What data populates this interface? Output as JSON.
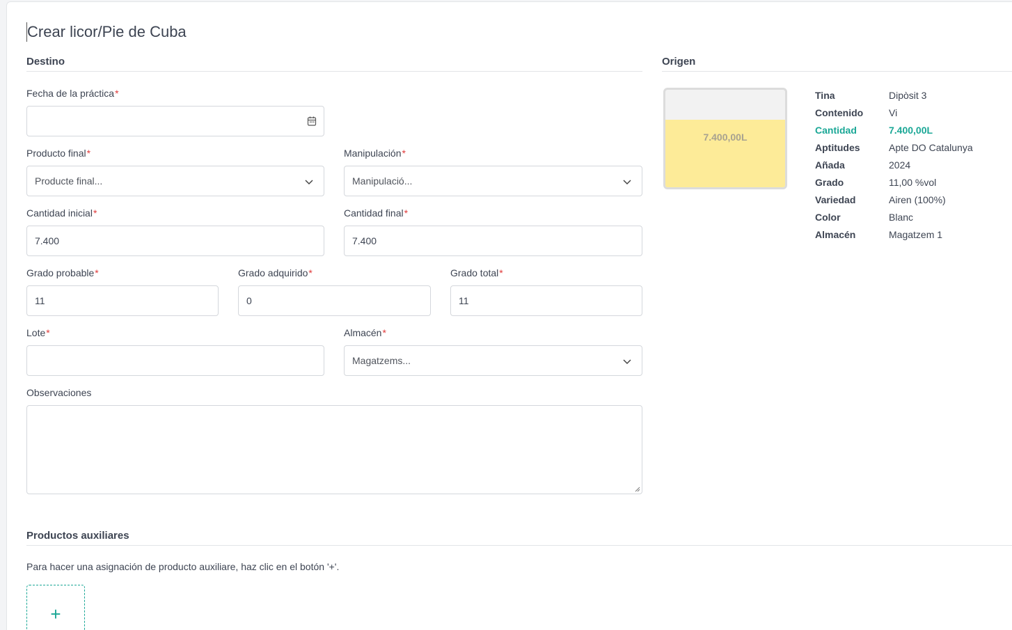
{
  "page": {
    "title": "Crear licor/Pie de Cuba"
  },
  "destino": {
    "title": "Destino",
    "fecha": {
      "label": "Fecha de la práctica",
      "value": ""
    },
    "producto_final": {
      "label": "Producto final",
      "placeholder": "Producte final..."
    },
    "manipulacion": {
      "label": "Manipulación",
      "placeholder": "Manipulació..."
    },
    "cantidad_inicial": {
      "label": "Cantidad inicial",
      "value": "7.400"
    },
    "cantidad_final": {
      "label": "Cantidad final",
      "value": "7.400"
    },
    "grado_probable": {
      "label": "Grado probable",
      "value": "11"
    },
    "grado_adquirido": {
      "label": "Grado adquirido",
      "value": "0"
    },
    "grado_total": {
      "label": "Grado total",
      "value": "11"
    },
    "lote": {
      "label": "Lote",
      "value": ""
    },
    "almacen": {
      "label": "Almacén",
      "placeholder": "Magatzems..."
    },
    "observaciones": {
      "label": "Observaciones",
      "value": ""
    },
    "required_mark": "*"
  },
  "origen": {
    "title": "Origen",
    "tank": {
      "label": "7.400,00L",
      "fill_fraction": 0.69,
      "fill_color": "#fdeb98"
    },
    "info": [
      {
        "key": "Tina",
        "value": "Dipòsit 3"
      },
      {
        "key": "Contenido",
        "value": "Vi"
      },
      {
        "key": "Cantidad",
        "value": "7.400,00L",
        "accent": true
      },
      {
        "key": "Aptitudes",
        "value": "Apte DO Catalunya"
      },
      {
        "key": "Añada",
        "value": "2024"
      },
      {
        "key": "Grado",
        "value": "11,00 %vol"
      },
      {
        "key": "Variedad",
        "value": "Airen (100%)"
      },
      {
        "key": "Color",
        "value": "Blanc"
      },
      {
        "key": "Almacén",
        "value": "Magatzem 1"
      }
    ]
  },
  "auxiliares": {
    "title": "Productos auxiliares",
    "help": "Para hacer una asignación de producto auxiliare, haz clic en el botón '+'.",
    "add_label": "+"
  },
  "colors": {
    "accent": "#1aa796",
    "required": "#e03a3a"
  }
}
